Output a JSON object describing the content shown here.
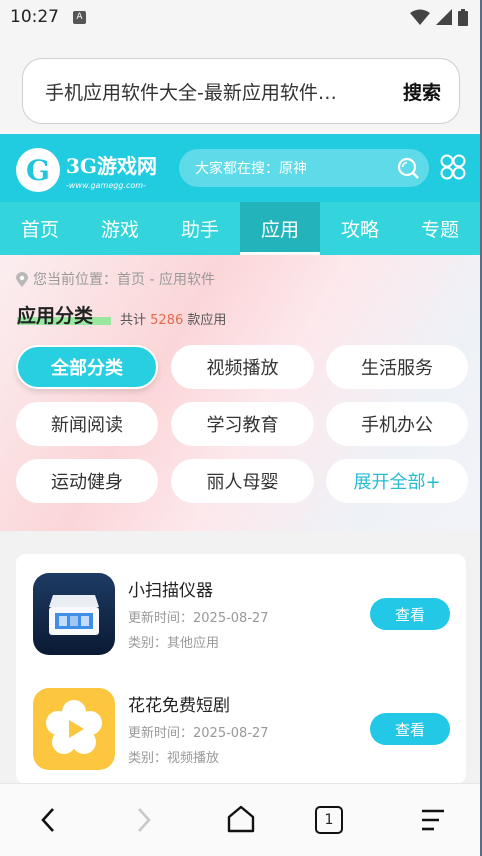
{
  "status": {
    "time": "10:27",
    "badge": "A"
  },
  "browser": {
    "url_text": "手机应用软件大全-最新应用软件…",
    "search_label": "搜索"
  },
  "site": {
    "logo_mark": "G",
    "logo_name": "3G游戏网",
    "logo_url": "-www.gamegg.com-",
    "search_placeholder": "大家都在搜：原神"
  },
  "nav": [
    "首页",
    "游戏",
    "助手",
    "应用",
    "攻略",
    "专题"
  ],
  "nav_active": "应用",
  "breadcrumb": "您当前位置：首页 - 应用软件",
  "category": {
    "title": "应用分类",
    "count_prefix": "共计",
    "count": "5286",
    "count_suffix": "款应用",
    "chips": [
      "全部分类",
      "视频播放",
      "生活服务",
      "新闻阅读",
      "学习教育",
      "手机办公",
      "运动健身",
      "丽人母婴",
      "展开全部+"
    ]
  },
  "apps": [
    {
      "name": "小扫描仪器",
      "updated": "更新时间：2025-08-27",
      "category": "类别：其他应用",
      "button": "查看"
    },
    {
      "name": "花花免费短剧",
      "updated": "更新时间：2025-08-27",
      "category": "类别：视频播放",
      "button": "查看"
    }
  ],
  "bottom": {
    "tab_count": "1"
  },
  "colors": {
    "brand": "#22cce0",
    "nav": "#33d4db",
    "nav_active": "#23b3ba",
    "button": "#22c8e6",
    "count": "#e8674d"
  }
}
